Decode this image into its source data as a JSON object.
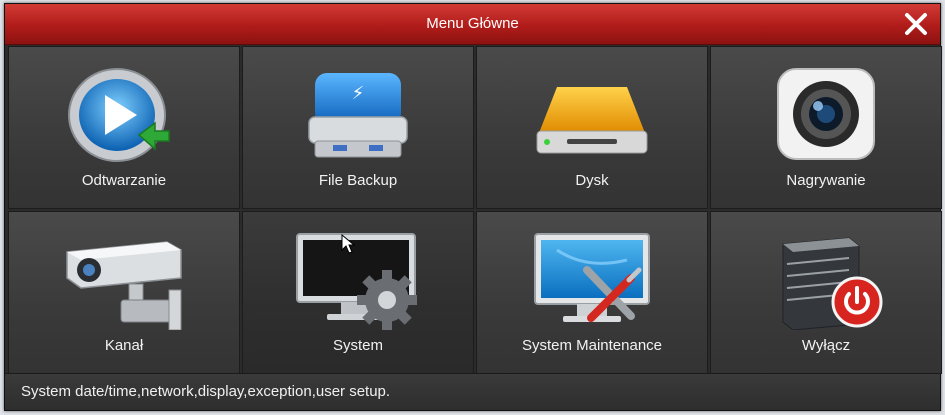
{
  "window": {
    "title": "Menu Główne"
  },
  "tiles": [
    {
      "label": "Odtwarzanie",
      "icon": "playback-icon"
    },
    {
      "label": "File Backup",
      "icon": "usb-drive-icon"
    },
    {
      "label": "Dysk",
      "icon": "hard-disk-icon"
    },
    {
      "label": "Nagrywanie",
      "icon": "camera-lens-icon"
    },
    {
      "label": "Kanał",
      "icon": "security-camera-icon"
    },
    {
      "label": "System",
      "icon": "monitor-gear-icon"
    },
    {
      "label": "System Maintenance",
      "icon": "monitor-tools-icon"
    },
    {
      "label": "Wyłącz",
      "icon": "server-power-icon"
    }
  ],
  "status": {
    "text": "System date/time,network,display,exception,user setup."
  },
  "colors": {
    "title_bar": "#b01c1a",
    "panel": "#3a3a3a",
    "text": "#ffffff"
  }
}
